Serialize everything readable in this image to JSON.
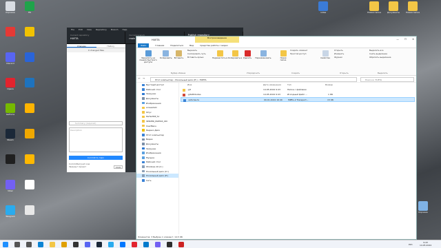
{
  "desktop_left": [
    {
      "label": "Корзина",
      "color": "#d9dde3"
    },
    {
      "label": "HS",
      "color": "#1fa34a"
    },
    {
      "label": "",
      "color": "#e53935"
    },
    {
      "label": "",
      "color": "#f2c200"
    },
    {
      "label": "Discord",
      "color": "#5865f2"
    },
    {
      "label": "",
      "color": "#2a64d8"
    },
    {
      "label": "Opera",
      "color": "#e2232e"
    },
    {
      "label": "",
      "color": "#1e73be"
    },
    {
      "label": "GeForce",
      "color": "#76b900"
    },
    {
      "label": "",
      "color": "#ffb400"
    },
    {
      "label": "Steam",
      "color": "#1b2838"
    },
    {
      "label": "",
      "color": "#f0a800"
    },
    {
      "label": "",
      "color": "#202020"
    },
    {
      "label": "",
      "color": "#ffb800"
    },
    {
      "label": "Viber",
      "color": "#7360f2"
    },
    {
      "label": "",
      "color": "#ffffff"
    },
    {
      "label": "Telegram",
      "color": "#2aabee"
    },
    {
      "label": "",
      "color": "#e8e8e8"
    }
  ],
  "desktop_right": [
    {
      "label": "notes",
      "color": "#3b7bd6"
    },
    {
      "label": "Новая папка",
      "color": "#f3c646"
    },
    {
      "label": "Документы",
      "color": "#f3c646"
    },
    {
      "label": "Новая папка",
      "color": "#f3c646"
    },
    {
      "label": "Корзина",
      "color": "#7fb2e5"
    }
  ],
  "github": {
    "menu": [
      "File",
      "Edit",
      "View",
      "Repository",
      "Branch",
      "Help"
    ],
    "current_repository_label": "Current repository",
    "current_repository": "HUETA",
    "current_branch_label": "Current branch",
    "current_branch": "main",
    "publish_title": "Publish repository",
    "publish_sub": "Publish this repository to GitHub",
    "tab_changes": "Changes",
    "tab_history": "History",
    "changed_files": "0 changed files",
    "summary_placeholder": "Summary (required)",
    "description_placeholder": "Description",
    "commit_button": "Commit to main",
    "committed_line1": "Committed just now",
    "committed_line2": "Звиниут проект",
    "undo": "Undo"
  },
  "explorer": {
    "title": "HUETA",
    "context_tab_title": "Воспроизведение",
    "ribbon_tabs": [
      "Файл",
      "Главная",
      "Поделиться",
      "Вид",
      "Средства работы с видео"
    ],
    "ribbon_items": {
      "pin": "Закрепить на панели быстрого доступа",
      "copy": "Копировать",
      "paste": "Вставить",
      "cut": "Вырезать",
      "copy_path": "Скопировать путь",
      "paste_shortcut": "Вставить ярлык",
      "move_to": "Переместить в",
      "copy_to": "Копировать в",
      "delete": "Удалить",
      "rename": "Переименовать",
      "new_folder": "Новая папка",
      "new_item": "Создать элемент",
      "easy_access": "Простой доступ",
      "properties": "Свойства",
      "open": "Открыть",
      "edit": "Изменить",
      "history": "Журнал",
      "select_all": "Выделить все",
      "select_none": "Снять выделение",
      "invert": "Обратить выделение"
    },
    "groups": [
      "Буфер обмена",
      "Упорядочить",
      "Создать",
      "Открыть",
      "Выделить"
    ],
    "path": "Этот компьютер  ›  Локальный диск (E:)  ›  HUETA",
    "search_placeholder": "Поиск в: HUETA",
    "nav_items": [
      {
        "label": "Быстрый доступ",
        "color": "#3a82d6"
      },
      {
        "label": "Рабочий стол",
        "color": "#3a82d6"
      },
      {
        "label": "Загрузки",
        "color": "#2f7ad3"
      },
      {
        "label": "Документы",
        "color": "#7b8fa8"
      },
      {
        "label": "Изображения",
        "color": "#5aa0e0"
      },
      {
        "label": "screeshotc",
        "color": "#f3c646"
      },
      {
        "label": "Опус",
        "color": "#f3c646"
      },
      {
        "label": "PerfectRP_Sc",
        "color": "#f3c646"
      },
      {
        "label": "SERVER_MATRIX_ON",
        "color": "#f3c646"
      },
      {
        "label": "UserMenu",
        "color": "#f3c646"
      },
      {
        "label": "Яндекс.Диск",
        "color": "#f0c000"
      },
      {
        "label": "Этот компьютер",
        "color": "#3a82d6"
      },
      {
        "label": "Видео",
        "color": "#7b8fa8"
      },
      {
        "label": "Документы",
        "color": "#7b8fa8"
      },
      {
        "label": "Загрузки",
        "color": "#2f7ad3"
      },
      {
        "label": "Изображения",
        "color": "#5aa0e0"
      },
      {
        "label": "Музыка",
        "color": "#5aa0e0"
      },
      {
        "label": "Рабочий стол",
        "color": "#3a82d6"
      },
      {
        "label": "Windows 10 (C:)",
        "color": "#8aa0b8"
      },
      {
        "label": "Локальный диск (D:)",
        "color": "#8aa0b8"
      },
      {
        "label": "Локальный диск (E:)",
        "color": "#8aa0b8"
      },
      {
        "label": "Сеть",
        "color": "#3a82d6"
      }
    ],
    "columns": [
      "Имя",
      "Дата изменения",
      "Тип",
      "Размер"
    ],
    "files": [
      {
        "name": ".git",
        "date": "14.05.2024 9:43",
        "type": "Папка с файлами",
        "size": "",
        "color": "#f3c646"
      },
      {
        "name": ".gitattributes",
        "date": "14.05.2024 9:43",
        "type": "Исходный файл ...",
        "size": "1 КБ",
        "color": "#d14b3a"
      },
      {
        "name": "vehicles.ts",
        "date": "09.01.2024 16:40",
        "type": "MPEG-2 Transport...",
        "size": "15 КБ",
        "color": "#3a82d6"
      }
    ],
    "status": "Элементов: 3   Выбран 1 элемент: 14,5 КБ"
  },
  "taskbar": {
    "time": "9:43",
    "date": "14.05.2024",
    "lang": "РУС",
    "apps": [
      {
        "name": "start",
        "color": "#1e90ff"
      },
      {
        "name": "search",
        "color": "#555"
      },
      {
        "name": "taskview",
        "color": "#555"
      },
      {
        "name": "edge",
        "color": "#0c84d4"
      },
      {
        "name": "explorer",
        "color": "#f3c646"
      },
      {
        "name": "chrome",
        "color": "#e0a000"
      },
      {
        "name": "github",
        "color": "#333"
      },
      {
        "name": "discord",
        "color": "#5865f2"
      },
      {
        "name": "steam",
        "color": "#1b2838"
      },
      {
        "name": "telegram",
        "color": "#2aabee"
      },
      {
        "name": "vk",
        "color": "#0077ff"
      },
      {
        "name": "opera",
        "color": "#e2232e"
      },
      {
        "name": "code",
        "color": "#007acc"
      },
      {
        "name": "viber",
        "color": "#7360f2"
      },
      {
        "name": "app",
        "color": "#2c2c2c"
      },
      {
        "name": "app2",
        "color": "#cc2222"
      }
    ]
  }
}
